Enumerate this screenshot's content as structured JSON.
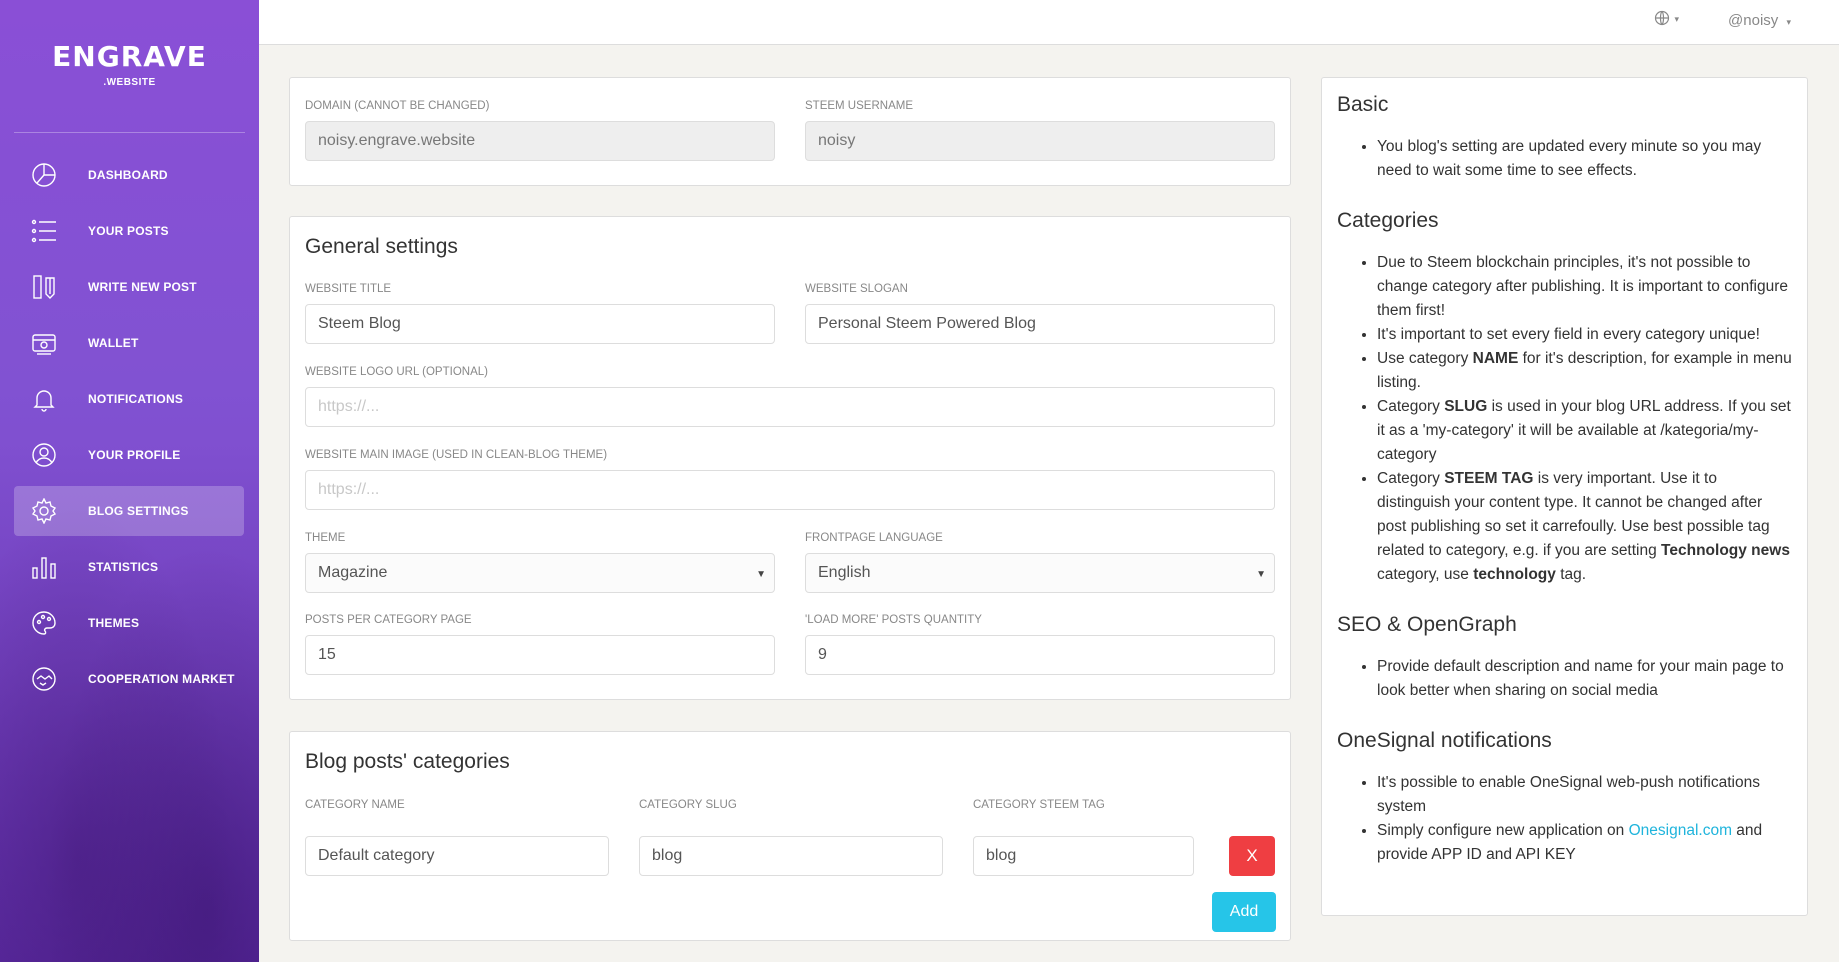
{
  "brand": {
    "name": "ENGRAVE",
    "sub": ".WEBSITE"
  },
  "nav": [
    {
      "label": "DASHBOARD",
      "icon": "pie-chart-icon",
      "active": false
    },
    {
      "label": "YOUR POSTS",
      "icon": "list-icon",
      "active": false
    },
    {
      "label": "WRITE NEW POST",
      "icon": "pencil-icon",
      "active": false
    },
    {
      "label": "WALLET",
      "icon": "wallet-icon",
      "active": false
    },
    {
      "label": "NOTIFICATIONS",
      "icon": "bell-icon",
      "active": false
    },
    {
      "label": "YOUR PROFILE",
      "icon": "user-icon",
      "active": false
    },
    {
      "label": "BLOG SETTINGS",
      "icon": "gear-icon",
      "active": true
    },
    {
      "label": "STATISTICS",
      "icon": "bar-chart-icon",
      "active": false
    },
    {
      "label": "THEMES",
      "icon": "palette-icon",
      "active": false
    },
    {
      "label": "COOPERATION MARKET",
      "icon": "handshake-icon",
      "active": false
    }
  ],
  "topbar": {
    "user": "@noisy",
    "language_icon": "globe-icon"
  },
  "domain_card": {
    "domain_label": "DOMAIN (CANNOT BE CHANGED)",
    "domain_value": "noisy.engrave.website",
    "username_label": "STEEM USERNAME",
    "username_value": "noisy"
  },
  "general": {
    "title": "General settings",
    "website_title_label": "WEBSITE TITLE",
    "website_title_value": "Steem Blog",
    "website_slogan_label": "WEBSITE SLOGAN",
    "website_slogan_value": "Personal Steem Powered Blog",
    "logo_label": "WEBSITE LOGO URL (OPTIONAL)",
    "logo_placeholder": "https://...",
    "main_image_label": "WEBSITE MAIN IMAGE (USED IN CLEAN-BLOG THEME)",
    "main_image_placeholder": "https://...",
    "theme_label": "THEME",
    "theme_value": "Magazine",
    "language_label": "FRONTPAGE LANGUAGE",
    "language_value": "English",
    "posts_per_page_label": "POSTS PER CATEGORY PAGE",
    "posts_per_page_value": "15",
    "load_more_label": "'LOAD MORE' POSTS QUANTITY",
    "load_more_value": "9"
  },
  "categories": {
    "title": "Blog posts' categories",
    "name_label": "CATEGORY NAME",
    "slug_label": "CATEGORY SLUG",
    "tag_label": "CATEGORY STEEM TAG",
    "rows": [
      {
        "name": "Default category",
        "slug": "blog",
        "tag": "blog"
      }
    ],
    "remove_label": "X",
    "add_label": "Add"
  },
  "help": {
    "basic_title": "Basic",
    "basic_1": "You blog's setting are updated every minute so you may need to wait some time to see effects.",
    "categories_title": "Categories",
    "cat_1": "Due to Steem blockchain principles, it's not possible to change category after publishing. It is important to configure them first!",
    "cat_2": "It's important to set every field in every category unique!",
    "cat_3_a": "Use category ",
    "cat_3_b": "NAME",
    "cat_3_c": " for it's description, for example in menu listing.",
    "cat_4_a": "Category ",
    "cat_4_b": "SLUG",
    "cat_4_c": " is used in your blog URL address. If you set it as a 'my-category' it will be available at /kategoria/my-category",
    "cat_5_a": "Category ",
    "cat_5_b": "STEEM TAG",
    "cat_5_c": " is very important. Use it to distinguish your content type. It cannot be changed after post publishing so set it carrefoully. Use best possible tag related to category, e.g. if you are setting ",
    "cat_5_d": "Technology news",
    "cat_5_e": " category, use ",
    "cat_5_f": "technology",
    "cat_5_g": " tag.",
    "seo_title": "SEO & OpenGraph",
    "seo_1": "Provide default description and name for your main page to look better when sharing on social media",
    "onesignal_title": "OneSignal notifications",
    "os_1": "It's possible to enable OneSignal web-push notifications system",
    "os_2_a": "Simply configure new application on ",
    "os_2_link": "Onesignal.com",
    "os_2_b": " and provide APP ID and API KEY"
  },
  "colors": {
    "accent": "#26c5e8",
    "danger": "#ef3e42",
    "sidebar": "#8152d2"
  }
}
